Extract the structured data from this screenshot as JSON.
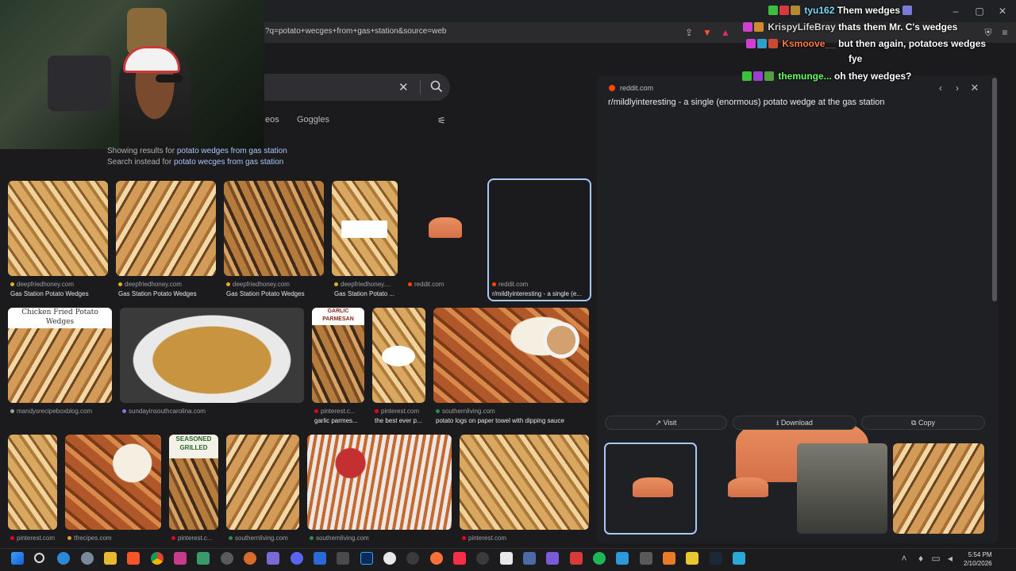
{
  "browser": {
    "url": "?q=potato+wecges+from+gas+station&source=web"
  },
  "search": {
    "tabs": [
      "eos",
      "Goggles"
    ],
    "showing_prefix": "Showing results for",
    "showing_query": "potato wedges from gas station",
    "instead_prefix": "Search instead for",
    "instead_query": "potato wecges from gas station"
  },
  "results": {
    "row1": [
      {
        "source": "deepfriedhoney.com",
        "caption": "Gas Station Potato Wedges"
      },
      {
        "source": "deepfriedhoney.com",
        "caption": "Gas Station Potato Wedges"
      },
      {
        "source": "deepfriedhoney.com",
        "caption": "Gas Station Potato Wedges"
      },
      {
        "source": "deepfriedhoney....",
        "caption": "Gas Station Potato ..."
      },
      {
        "source": "reddit.com",
        "caption": ""
      },
      {
        "source": "reddit.com",
        "caption": "r/mildlyinteresting - a single (e..."
      }
    ],
    "row2": [
      {
        "source": "mandysrecipeboxblog.com",
        "caption": "",
        "overlay": "Chicken Fried Potato Wedges"
      },
      {
        "source": "sundayinsouthcarolina.com",
        "caption": ""
      },
      {
        "source": "pinterest.c...",
        "caption": "garlic parmes...",
        "overlay": "GARLIC PARMESAN"
      },
      {
        "source": "pinterest.com",
        "caption": "the best ever p..."
      },
      {
        "source": "southernliving.com",
        "caption": "potato logs on paper towel with dipping sauce"
      }
    ],
    "row3": [
      {
        "source": "pinterest.com"
      },
      {
        "source": "tfrecipes.com"
      },
      {
        "source": "pinterest.c...",
        "overlay": "SEASONED GRILLED"
      },
      {
        "source": "southernliving.com"
      },
      {
        "source": "southernliving.com"
      },
      {
        "source": "pinterest.com"
      }
    ]
  },
  "preview": {
    "source": "reddit.com",
    "title": "r/mildlyinteresting - a single (enormous) potato wedge at the gas station",
    "actions": {
      "visit": "Visit",
      "download": "Download",
      "copy": "Copy"
    }
  },
  "chat": [
    {
      "user": "tyu162",
      "user_color": "#7fd6ff",
      "message": "Them wedges"
    },
    {
      "user": "KrispyLifeBray",
      "user_color": "#d8d8d8",
      "message": "thats them Mr. C's wedges"
    },
    {
      "user": "Ksmoove__",
      "user_color": "#ff7a45",
      "message": "but then again, potatoes wedges"
    },
    {
      "user": "",
      "user_color": "#ffffff",
      "message": "fye"
    },
    {
      "user": "themunge...",
      "user_color": "#66ff66",
      "message": "oh they wedges?"
    }
  ],
  "taskbar": {
    "time": "5:54 PM",
    "date": "2/10/2026"
  }
}
